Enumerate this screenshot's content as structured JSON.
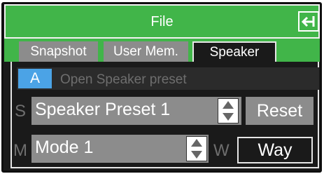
{
  "header": {
    "title": "File",
    "back_icon": "back-arrow-icon"
  },
  "tabs": [
    {
      "label": "Snapshot",
      "active": false
    },
    {
      "label": "User Mem.",
      "active": false
    },
    {
      "label": "Speaker",
      "active": true
    }
  ],
  "preset": {
    "badge": "A",
    "label": "Open Speaker preset"
  },
  "speaker_row": {
    "letter": "S",
    "value": "Speaker Preset 1",
    "reset_label": "Reset"
  },
  "mode_row": {
    "letter": "M",
    "value": "Mode 1",
    "w_letter": "W",
    "way_label": "Way"
  },
  "colors": {
    "accent_green": "#41b549",
    "badge_blue": "#4ba3e6",
    "field_gray": "#8c8c8c",
    "background": "#1a1a1a"
  }
}
